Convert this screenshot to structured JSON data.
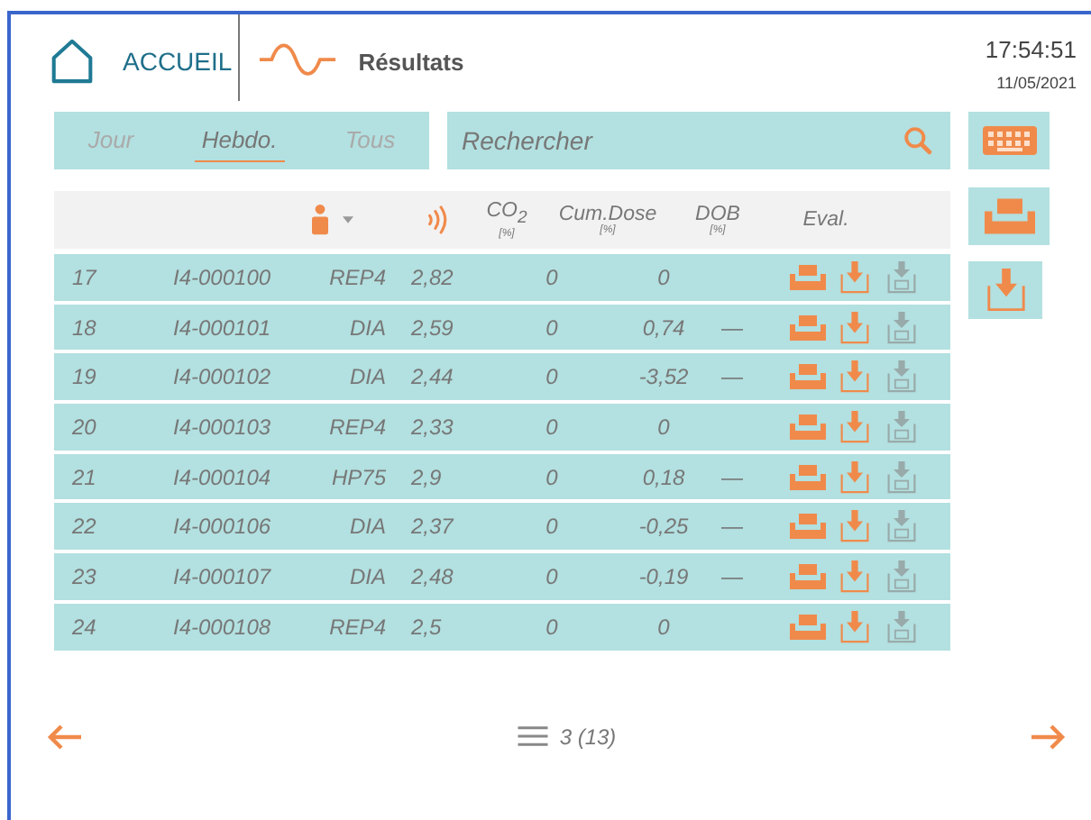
{
  "header": {
    "home_label": "ACCUEIL",
    "title": "Résultats",
    "time": "17:54:51",
    "date": "11/05/2021"
  },
  "period_tabs": [
    {
      "label": "Jour",
      "selected": false
    },
    {
      "label": "Hebdo.",
      "selected": true
    },
    {
      "label": "Tous",
      "selected": false
    }
  ],
  "search": {
    "placeholder": "Rechercher"
  },
  "columns": [
    {
      "kind": "blank"
    },
    {
      "kind": "person"
    },
    {
      "kind": "sound"
    },
    {
      "kind": "text",
      "label": "CO$_{2}$",
      "unit": "[%]"
    },
    {
      "kind": "text",
      "label": "Cum.Dose",
      "unit": "[%]"
    },
    {
      "kind": "text",
      "label": "DOB",
      "unit": "[%]"
    },
    {
      "kind": "text",
      "label": "Eval."
    }
  ],
  "rows": [
    {
      "index": "17",
      "id": "I4-000100",
      "type": "REP4",
      "co2": "2,82",
      "cum_dose": "0",
      "dob": "0"
    },
    {
      "index": "18",
      "id": "I4-000101",
      "type": "DIA",
      "co2": "2,59",
      "cum_dose": "0",
      "dob": "0,74",
      "eval": "—"
    },
    {
      "index": "19",
      "id": "I4-000102",
      "type": "DIA",
      "co2": "2,44",
      "cum_dose": "0",
      "dob": "-3,52",
      "eval": "—"
    },
    {
      "index": "20",
      "id": "I4-000103",
      "type": "REP4",
      "co2": "2,33",
      "cum_dose": "0",
      "dob": "0"
    },
    {
      "index": "21",
      "id": "I4-000104",
      "type": "HP75",
      "co2": "2,9",
      "cum_dose": "0",
      "dob": "0,18",
      "eval": "—"
    },
    {
      "index": "22",
      "id": "I4-000106",
      "type": "DIA",
      "co2": "2,37",
      "cum_dose": "0",
      "dob": "-0,25",
      "eval": "—"
    },
    {
      "index": "23",
      "id": "I4-000107",
      "type": "DIA",
      "co2": "2,48",
      "cum_dose": "0",
      "dob": "-0,19",
      "eval": "—"
    },
    {
      "index": "24",
      "id": "I4-000108",
      "type": "REP4",
      "co2": "2,5",
      "cum_dose": "0",
      "dob": "0"
    }
  ],
  "pagination": {
    "page": "3 (13)"
  }
}
